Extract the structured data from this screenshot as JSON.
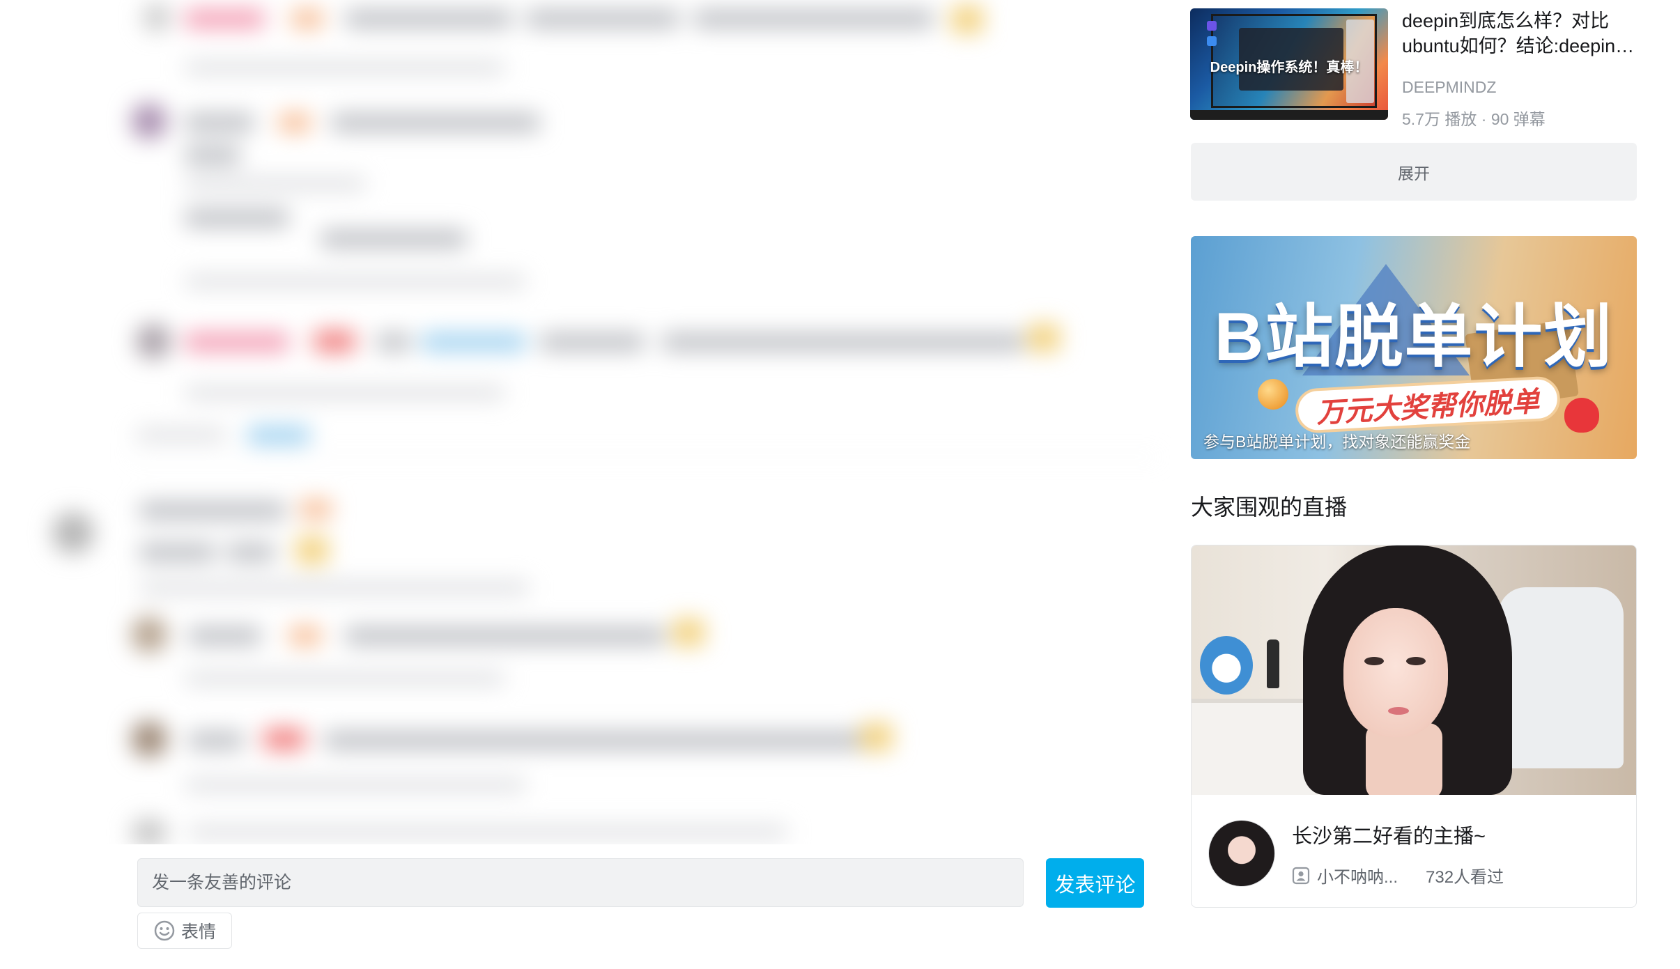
{
  "recommendation": {
    "thumbnail_text": "Deepin操作系统！真棒！",
    "title": "deepin到底怎么样？对比ubuntu如何？结论:deepin挺不错的",
    "author": "DEEPMINDZ",
    "plays": "5.7万 播放",
    "separator": "·",
    "danmaku": "90 弹幕"
  },
  "expand_label": "展开",
  "banner": {
    "title": "B站脱单计划",
    "ribbon": "万元大奖帮你脱单",
    "caption": "参与B站脱单计划，找对象还能赢奖金"
  },
  "live_section": {
    "heading": "大家围观的直播",
    "card": {
      "title": "长沙第二好看的主播~",
      "streamer": "小不呐呐...",
      "viewers": "732人看过"
    }
  },
  "composer": {
    "placeholder": "发一条友善的评论",
    "submit_label": "发表评论",
    "emoji_label": "表情"
  },
  "colors": {
    "accent": "#00aeec",
    "text_primary": "#18191c",
    "text_secondary": "#9499a0",
    "panel_bg": "#f1f2f3"
  }
}
